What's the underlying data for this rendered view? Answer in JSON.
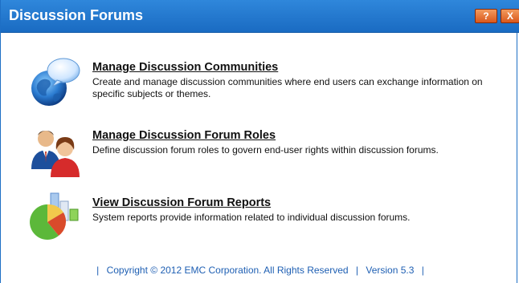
{
  "window": {
    "title": "Discussion Forums",
    "help_label": "?",
    "close_label": "X"
  },
  "items": [
    {
      "link": "Manage Discussion Communities",
      "desc": "Create and manage discussion communities where end users can exchange information on specific subjects or themes.",
      "icon": "globe-chat-icon"
    },
    {
      "link": "Manage Discussion Forum Roles",
      "desc": "Define discussion forum roles to govern end-user rights within discussion forums.",
      "icon": "users-roles-icon"
    },
    {
      "link": "View Discussion Forum Reports",
      "desc": "System reports provide information related to individual discussion forums.",
      "icon": "reports-chart-icon"
    }
  ],
  "footer": {
    "sep1": "|",
    "copyright": "Copyright © 2012 EMC Corporation.  All Rights Reserved",
    "sep2": "|",
    "version": "Version 5.3",
    "sep3": "|"
  },
  "colors": {
    "titlebar": "#1a6bc2",
    "title_button": "#e0642a",
    "footer_text": "#1e5fb3"
  }
}
